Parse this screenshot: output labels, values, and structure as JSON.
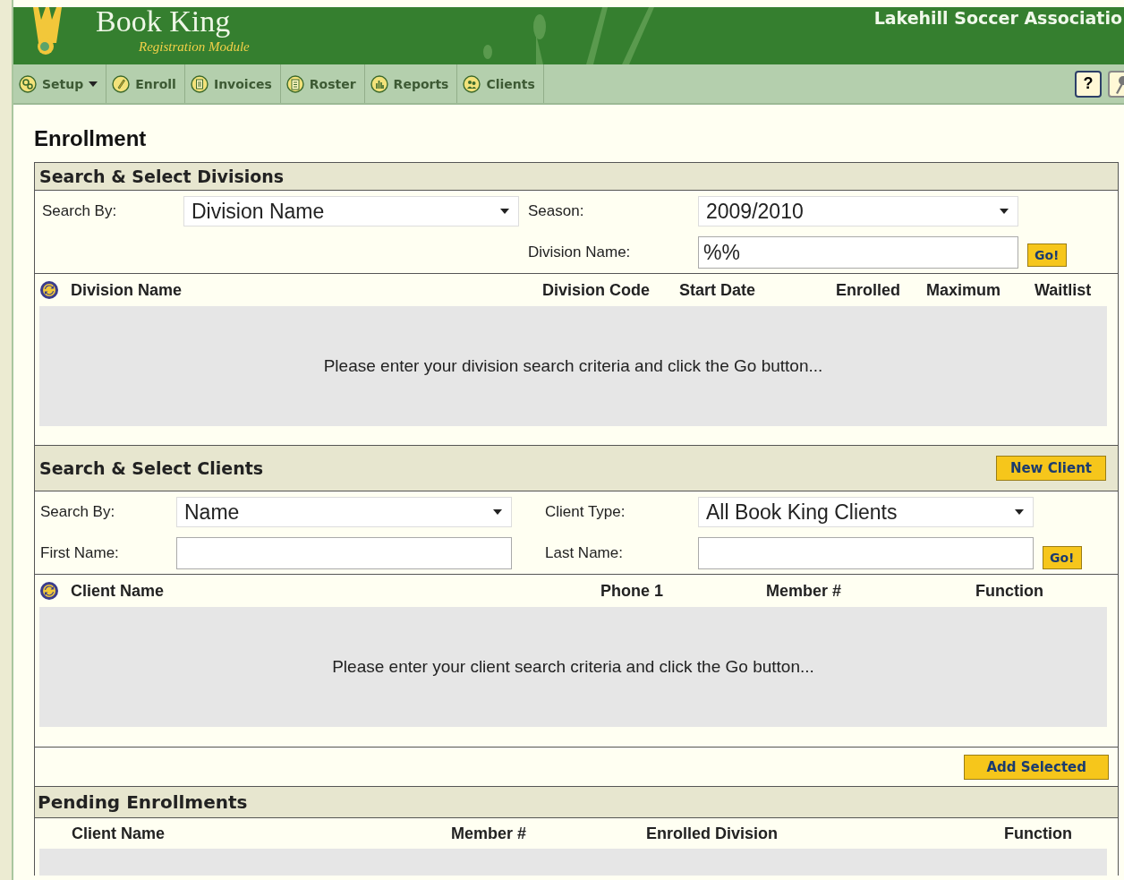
{
  "header": {
    "title": "Book King",
    "subtitle": "Registration Module",
    "organization": "Lakehill Soccer Associatio"
  },
  "nav": [
    {
      "label": "Setup",
      "dropdown": true
    },
    {
      "label": "Enroll",
      "dropdown": false
    },
    {
      "label": "Invoices",
      "dropdown": false
    },
    {
      "label": "Roster",
      "dropdown": false
    },
    {
      "label": "Reports",
      "dropdown": false
    },
    {
      "label": "Clients",
      "dropdown": false
    }
  ],
  "toolbar": [
    {
      "kind": "help",
      "label": "?"
    },
    {
      "kind": "key"
    }
  ],
  "page_title": "Enrollment",
  "divisions": {
    "title": "Search & Select Divisions",
    "fields": [
      {
        "label": "Search By:",
        "kind": "select",
        "value": "Division Name"
      },
      {
        "label": "Season:",
        "kind": "select",
        "value": "2009/2010"
      },
      {
        "label": "Division Name:",
        "kind": "input",
        "value": "%%"
      }
    ],
    "go_button": "Go!",
    "columns": [
      "Division Name",
      "Division Code",
      "Start Date",
      "Enrolled",
      "Maximum",
      "Waitlist"
    ],
    "empty_message": "Please enter your division search criteria and click the Go button..."
  },
  "clients": {
    "title": "Search & Select Clients",
    "new_button": "New Client",
    "fields": [
      {
        "label": "Search By:",
        "kind": "select",
        "value": "Name"
      },
      {
        "label": "Client Type:",
        "kind": "select",
        "value": "All Book King Clients"
      },
      {
        "label": "First Name:",
        "kind": "input"
      },
      {
        "label": "Last Name:",
        "kind": "input"
      }
    ],
    "go_button": "Go!",
    "columns": [
      "Client Name",
      "Phone 1",
      "Member #",
      "Function"
    ],
    "empty_message": "Please enter your client search criteria and click the Go button...",
    "add_button": "Add Selected"
  },
  "pending": {
    "title": "Pending Enrollments",
    "columns": [
      "Client Name",
      "Member #",
      "Enrolled Division",
      "Function"
    ]
  }
}
